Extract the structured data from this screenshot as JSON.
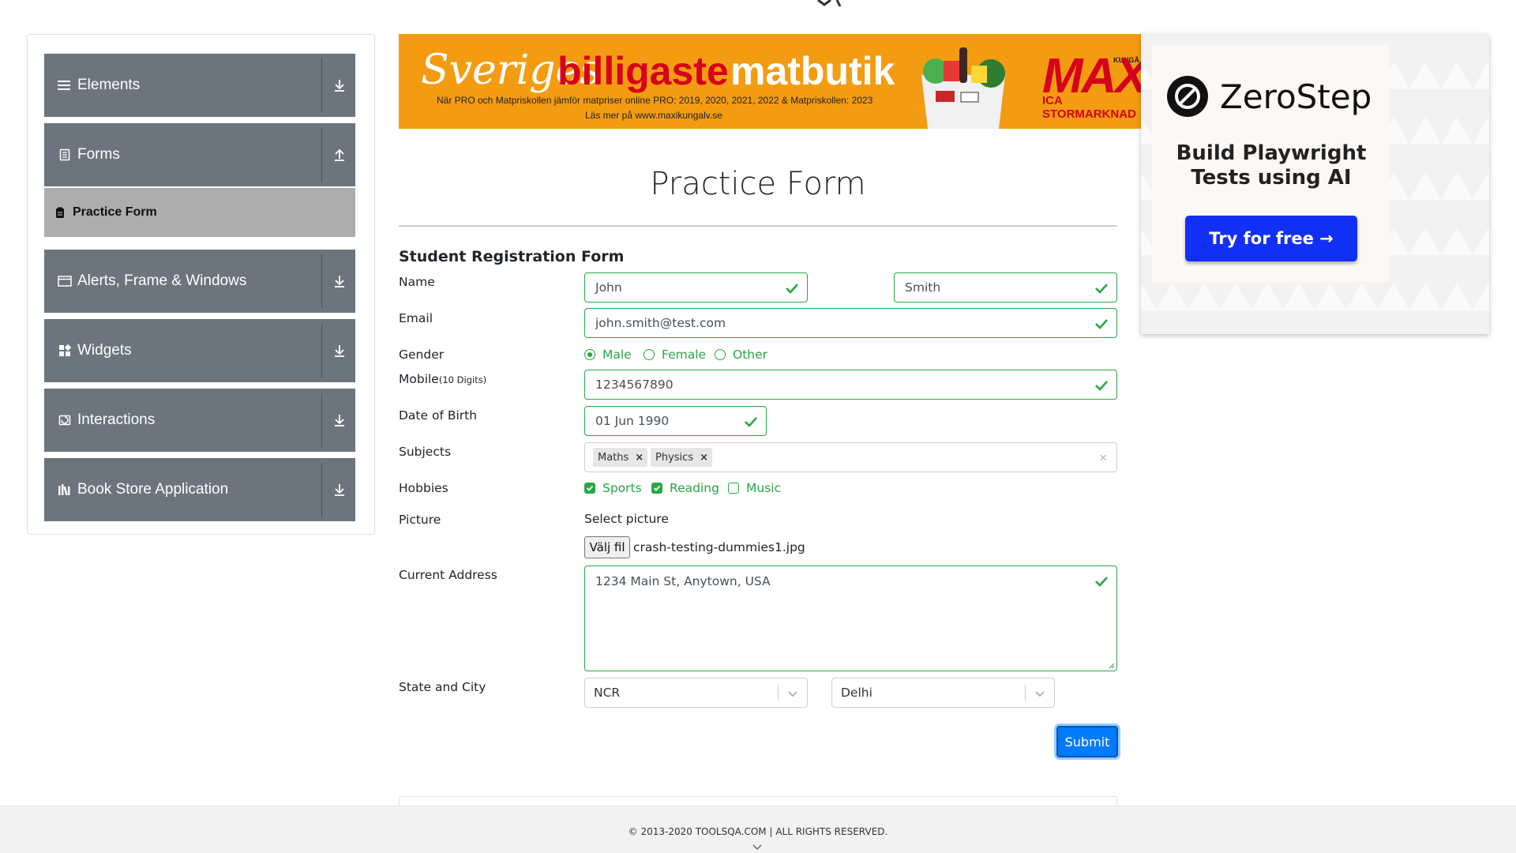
{
  "sidebar": {
    "groups": [
      {
        "label": "Elements",
        "icon": "hamburger-icon",
        "arrow": "download-icon"
      },
      {
        "label": "Forms",
        "icon": "document-icon",
        "arrow": "upload-icon"
      },
      {
        "label": "Alerts, Frame & Windows",
        "icon": "window-icon",
        "arrow": "download-icon"
      },
      {
        "label": "Widgets",
        "icon": "widgets-icon",
        "arrow": "download-icon"
      },
      {
        "label": "Interactions",
        "icon": "interactions-icon",
        "arrow": "download-icon"
      },
      {
        "label": "Book Store Application",
        "icon": "books-icon",
        "arrow": "download-icon"
      }
    ],
    "active_item": {
      "label": "Practice Form",
      "icon": "form-icon"
    }
  },
  "banner": {
    "script_text": "Sveriges",
    "headline_red": "billigaste",
    "headline_white": "matbutik",
    "line1": "När PRO och Matpriskollen jämför matpriser online PRO: 2019, 2020, 2021, 2022 & Matpriskollen: 2023",
    "line2": "Läs mer på www.maxikungalv.se",
    "maxi": "MAXI",
    "ica": "ICA STORMARKNAD",
    "kung": "KUNGÄ"
  },
  "ad": {
    "brand": "ZeroStep",
    "tagline_line1": "Build Playwright",
    "tagline_line2": "Tests using AI",
    "cta": "Try for free →"
  },
  "form": {
    "title": "Practice Form",
    "subtitle": "Student Registration Form",
    "labels": {
      "name": "Name",
      "email": "Email",
      "gender": "Gender",
      "mobile": "Mobile",
      "mobile_hint": "(10 Digits)",
      "dob": "Date of Birth",
      "subjects": "Subjects",
      "hobbies": "Hobbies",
      "picture": "Picture",
      "address": "Current Address",
      "state_city": "State and City"
    },
    "first_name": "John",
    "last_name": "Smith",
    "email": "john.smith@test.com",
    "gender_options": [
      {
        "label": "Male",
        "checked": true
      },
      {
        "label": "Female",
        "checked": false
      },
      {
        "label": "Other",
        "checked": false
      }
    ],
    "mobile": "1234567890",
    "dob": "01 Jun 1990",
    "subjects": [
      "Maths",
      "Physics"
    ],
    "hobbies": [
      {
        "label": "Sports",
        "checked": true
      },
      {
        "label": "Reading",
        "checked": true
      },
      {
        "label": "Music",
        "checked": false
      }
    ],
    "picture_label": "Select picture",
    "file_button": "Välj fil",
    "file_name": "crash-testing-dummies1.jpg",
    "address": "1234 Main St, Anytown, USA",
    "state": "NCR",
    "city": "Delhi",
    "submit": "Submit"
  },
  "footer": {
    "text": "© 2013-2020 TOOLSQA.COM | ALL RIGHTS RESERVED."
  },
  "colors": {
    "sidebar_group": "#6c757d",
    "sidebar_active": "#adadad",
    "valid_green": "#28a745",
    "submit_blue": "#007bff",
    "banner_orange": "#f39c12",
    "banner_red": "#d6001c",
    "cta_blue": "#1230f5"
  }
}
